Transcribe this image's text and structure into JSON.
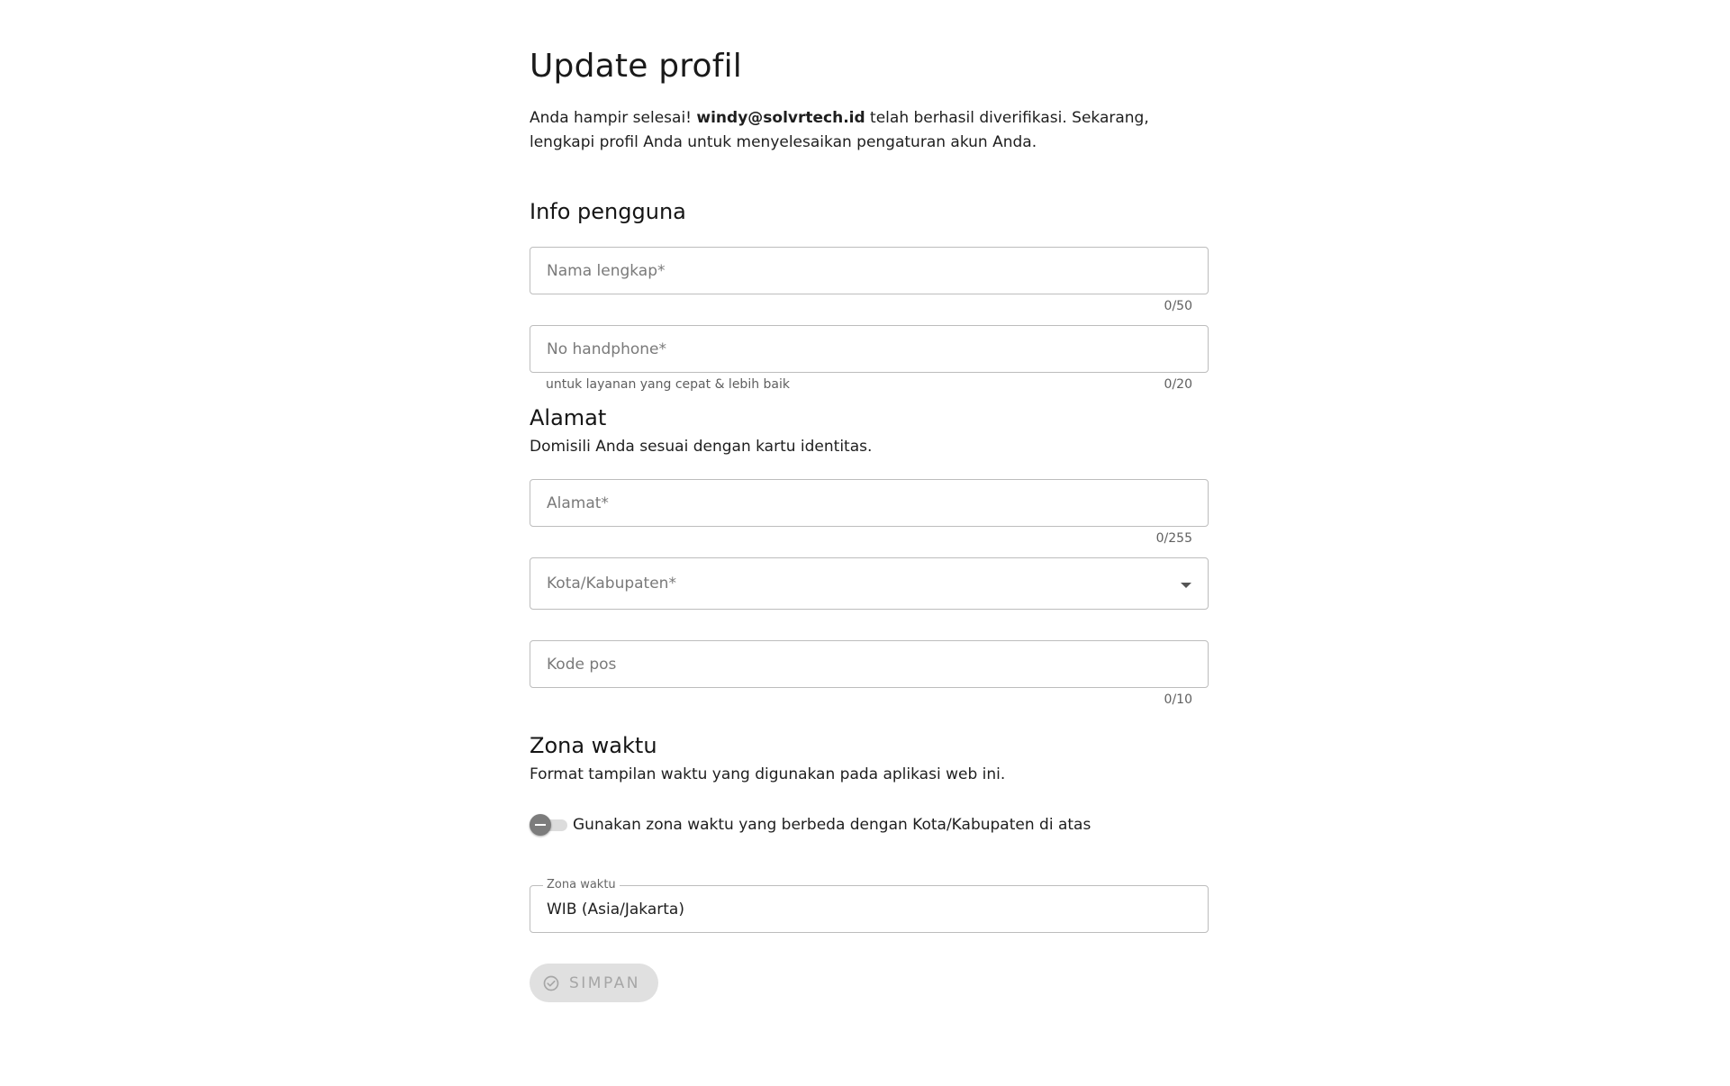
{
  "page": {
    "title": "Update profil",
    "intro_before": "Anda hampir selesai! ",
    "intro_email": "windy@solvrtech.id",
    "intro_after": " telah berhasil diverifikasi. Sekarang, lengkapi profil Anda untuk menyelesaikan pengaturan akun Anda."
  },
  "user_info": {
    "title": "Info pengguna",
    "full_name": {
      "placeholder": "Nama lengkap*",
      "value": "",
      "counter": "0/50"
    },
    "phone": {
      "placeholder": "No handphone*",
      "value": "",
      "hint": "untuk layanan yang cepat & lebih baik",
      "counter": "0/20"
    }
  },
  "address": {
    "title": "Alamat",
    "description": "Domisili Anda sesuai dengan kartu identitas.",
    "street": {
      "placeholder": "Alamat*",
      "value": "",
      "counter": "0/255"
    },
    "city": {
      "placeholder": "Kota/Kabupaten*",
      "icon": "chevron-down-icon"
    },
    "postal": {
      "placeholder": "Kode pos",
      "value": "",
      "counter": "0/10"
    }
  },
  "timezone": {
    "title": "Zona waktu",
    "description": "Format tampilan waktu yang digunakan pada aplikasi web ini.",
    "toggle_label": "Gunakan zona waktu yang berbeda dengan Kota/Kabupaten di atas",
    "toggle_on": false,
    "field_label": "Zona waktu",
    "field_value": "WIB (Asia/Jakarta)"
  },
  "actions": {
    "save_label": "SIMPAN",
    "save_icon": "check-circle-icon"
  },
  "colors": {
    "border": "#bdbdbd",
    "button_bg": "#e0e0e0",
    "button_text": "#a6a6a6",
    "toggle_thumb": "#7c7c7c"
  }
}
